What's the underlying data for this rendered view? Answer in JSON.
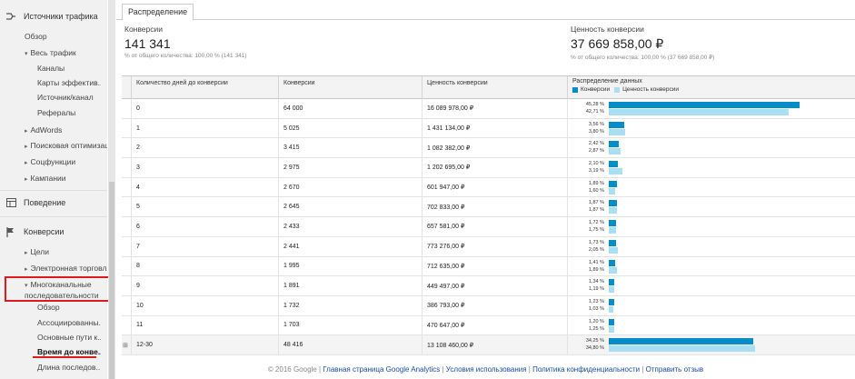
{
  "sidebar": {
    "traffic": {
      "label": "Источники трафика"
    },
    "overview": "Обзор",
    "all_traffic": "Весь трафик",
    "channels": "Каналы",
    "treemaps": "Карты эффектив...",
    "source_medium": "Источник/канал",
    "referrals": "Рефералы",
    "adwords": "AdWords",
    "seo": "Поисковая оптимизация",
    "social": "Соцфункции",
    "campaigns": "Кампании",
    "behavior": {
      "label": "Поведение"
    },
    "conversions": {
      "label": "Конверсии"
    },
    "goals": "Цели",
    "ecommerce": "Электронная торговля",
    "mcf": "Многоканальные последовательности",
    "mcf_overview": "Обзор",
    "assisted": "Ассоциированны...",
    "top_paths": "Основные пути к...",
    "time_lag": "Время до конве...",
    "path_length": "Длина последов..."
  },
  "tab": {
    "label": "Распределение"
  },
  "metrics": [
    {
      "title": "Конверсии",
      "value": "141 341",
      "sub": "% от общего количества: 100,00 % (141 341)"
    },
    {
      "title": "Ценность конверсии",
      "value": "37 669 858,00 ₽",
      "sub": "% от общего количества: 100,00 % (37 669 858,00 ₽)"
    }
  ],
  "table": {
    "headers": {
      "days": "Количество дней до конверсии",
      "conversions": "Конверсии",
      "value": "Ценность конверсии",
      "distribution": "Распределение данных"
    },
    "legend": {
      "conversions": "Конверсии",
      "value": "Ценность конверсии"
    },
    "rows": [
      {
        "days": "0",
        "conv": "64 000",
        "val": "16 089 978,00 ₽",
        "p1": "45,28 %",
        "p2": "42,71 %",
        "f1": 45.28,
        "f2": 42.71
      },
      {
        "days": "1",
        "conv": "5 025",
        "val": "1 431 134,00 ₽",
        "p1": "3,56 %",
        "p2": "3,80 %",
        "f1": 3.56,
        "f2": 3.8
      },
      {
        "days": "2",
        "conv": "3 415",
        "val": "1 082 382,00 ₽",
        "p1": "2,42 %",
        "p2": "2,87 %",
        "f1": 2.42,
        "f2": 2.87
      },
      {
        "days": "3",
        "conv": "2 975",
        "val": "1 202 695,00 ₽",
        "p1": "2,10 %",
        "p2": "3,19 %",
        "f1": 2.1,
        "f2": 3.19
      },
      {
        "days": "4",
        "conv": "2 670",
        "val": "601 947,00 ₽",
        "p1": "1,89 %",
        "p2": "1,60 %",
        "f1": 1.89,
        "f2": 1.6
      },
      {
        "days": "5",
        "conv": "2 645",
        "val": "702 833,00 ₽",
        "p1": "1,87 %",
        "p2": "1,87 %",
        "f1": 1.87,
        "f2": 1.87
      },
      {
        "days": "6",
        "conv": "2 433",
        "val": "657 581,00 ₽",
        "p1": "1,72 %",
        "p2": "1,75 %",
        "f1": 1.72,
        "f2": 1.75
      },
      {
        "days": "7",
        "conv": "2 441",
        "val": "773 276,00 ₽",
        "p1": "1,73 %",
        "p2": "2,05 %",
        "f1": 1.73,
        "f2": 2.05
      },
      {
        "days": "8",
        "conv": "1 995",
        "val": "712 635,00 ₽",
        "p1": "1,41 %",
        "p2": "1,89 %",
        "f1": 1.41,
        "f2": 1.89
      },
      {
        "days": "9",
        "conv": "1 891",
        "val": "449 497,00 ₽",
        "p1": "1,34 %",
        "p2": "1,19 %",
        "f1": 1.34,
        "f2": 1.19
      },
      {
        "days": "10",
        "conv": "1 732",
        "val": "386 793,00 ₽",
        "p1": "1,23 %",
        "p2": "1,03 %",
        "f1": 1.23,
        "f2": 1.03
      },
      {
        "days": "11",
        "conv": "1 703",
        "val": "470 647,00 ₽",
        "p1": "1,20 %",
        "p2": "1,25 %",
        "f1": 1.2,
        "f2": 1.25
      },
      {
        "days": "12-30",
        "conv": "48 416",
        "val": "13 108 460,00 ₽",
        "p1": "34,25 %",
        "p2": "34,80 %",
        "f1": 34.25,
        "f2": 34.8
      }
    ]
  },
  "colors": {
    "conv_bar": "#058dc7",
    "value_bar": "#aadff3",
    "highlight": "#e0191b"
  },
  "footer": {
    "copyright": "© 2016 Google",
    "home": "Главная страница Google Analytics",
    "terms": "Условия использования",
    "privacy": "Политика конфиденциальности",
    "feedback": "Отправить отзыв"
  }
}
